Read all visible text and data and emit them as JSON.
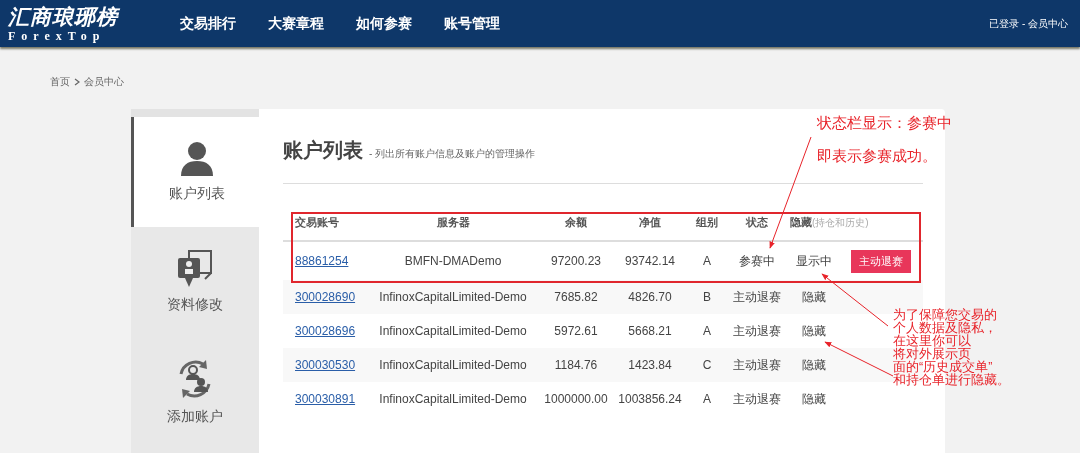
{
  "header": {
    "logo_title": "汇商琅琊榜",
    "logo_subtitle": "ForexTop",
    "nav": [
      {
        "label": "交易排行"
      },
      {
        "label": "大赛章程"
      },
      {
        "label": "如何参赛"
      },
      {
        "label": "账号管理"
      }
    ],
    "user_link": "已登录 - 会员中心"
  },
  "breadcrumb": [
    "首页",
    "会员中心"
  ],
  "sidebar": {
    "items": [
      {
        "label": "账户列表",
        "selected": true
      },
      {
        "label": "资料修改",
        "selected": false
      },
      {
        "label": "添加账户",
        "selected": false
      }
    ]
  },
  "main": {
    "title": "账户列表",
    "subtitle": "- 列出所有账户信息及账户的管理操作"
  },
  "table": {
    "columns": [
      {
        "label": "交易账号"
      },
      {
        "label": "服务器"
      },
      {
        "label": "余额"
      },
      {
        "label": "净值"
      },
      {
        "label": "组别"
      },
      {
        "label": "状态"
      },
      {
        "label": "隐藏",
        "note": "(持仓和历史)"
      }
    ],
    "rows": [
      {
        "account": "88861254",
        "server": "BMFN-DMADemo",
        "balance": "97200.23",
        "equity": "93742.14",
        "group": "A",
        "status": "参赛中",
        "hidden": "显示中",
        "action": "主动退赛"
      },
      {
        "account": "300028690",
        "server": "InfinoxCapitalLimited-Demo",
        "balance": "7685.82",
        "equity": "4826.70",
        "group": "B",
        "status": "主动退赛",
        "hidden": "隐藏"
      },
      {
        "account": "300028696",
        "server": "InfinoxCapitalLimited-Demo",
        "balance": "5972.61",
        "equity": "5668.21",
        "group": "A",
        "status": "主动退赛",
        "hidden": "隐藏"
      },
      {
        "account": "300030530",
        "server": "InfinoxCapitalLimited-Demo",
        "balance": "1184.76",
        "equity": "1423.84",
        "group": "C",
        "status": "主动退赛",
        "hidden": "隐藏"
      },
      {
        "account": "300030891",
        "server": "InfinoxCapitalLimited-Demo",
        "balance": "1000000.00",
        "equity": "1003856.24",
        "group": "A",
        "status": "主动退赛",
        "hidden": "隐藏"
      }
    ]
  },
  "annotations": [
    {
      "lines": [
        "状态栏显示：参赛中"
      ]
    },
    {
      "lines": [
        "即表示参赛成功。"
      ]
    },
    {
      "lines": [
        "为了保障您交易的",
        "个人数据及隐私，",
        "在这里你可以",
        "将对外展示页",
        "面的“历史成交单”",
        "和持仓单进行隐藏。"
      ]
    }
  ]
}
